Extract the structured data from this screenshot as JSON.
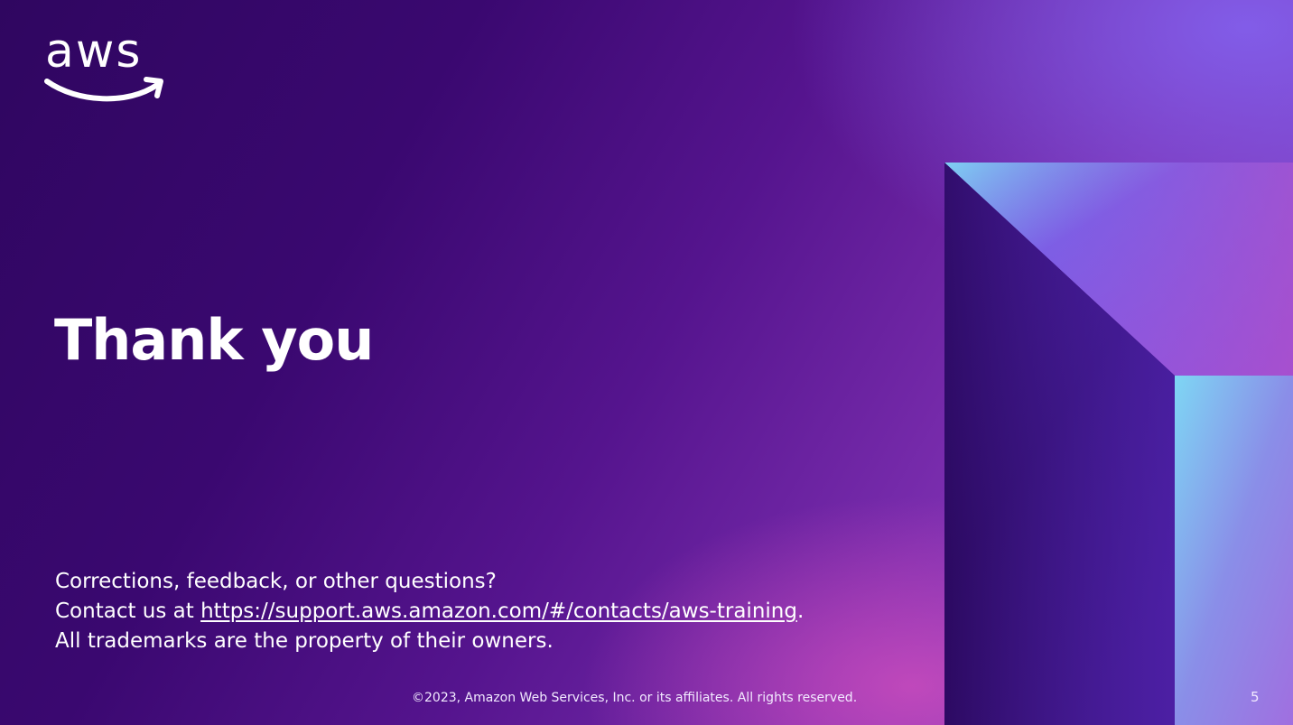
{
  "slide": {
    "title": "Thank you",
    "contact": {
      "line1": "Corrections, feedback, or other questions?",
      "line2_prefix": "Contact us at ",
      "link_text": "https://support.aws.amazon.com/#/contacts/aws-training",
      "line2_suffix": ".",
      "line3": "All trademarks are the property of their owners."
    },
    "footer": "©2023, Amazon Web Services, Inc. or its affiliates. All rights reserved.",
    "page_number": "5"
  },
  "logo": {
    "text": "aws",
    "icon": "aws-logo-icon"
  },
  "colors": {
    "background_dark": "#2f0660",
    "background_light": "#8a4ad0",
    "text": "#ffffff"
  }
}
